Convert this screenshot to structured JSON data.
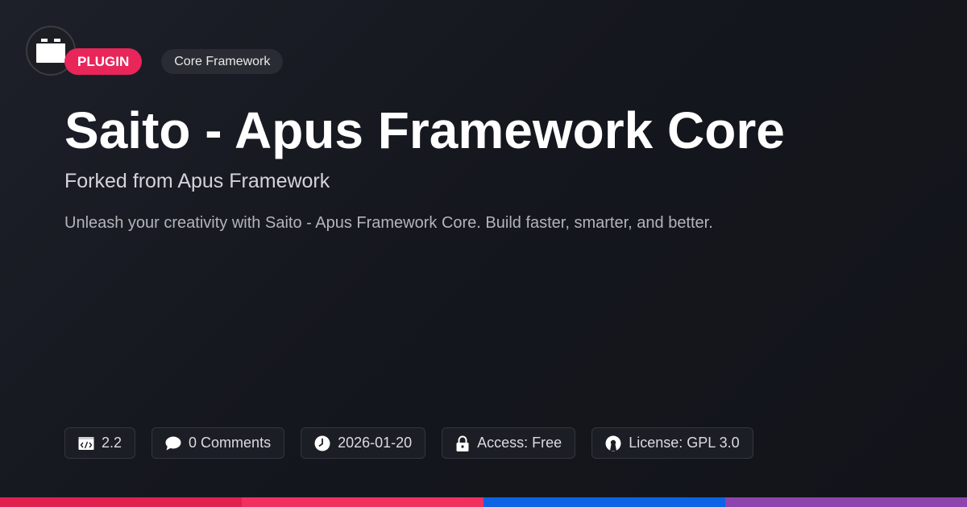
{
  "header": {
    "logo_icon": "plugin-block-icon",
    "type_badge": "PLUGIN",
    "category_badge": "Core Framework"
  },
  "main": {
    "title": "Saito - Apus Framework Core",
    "subtitle": "Forked from Apus Framework",
    "description": "Unleash your creativity with Saito - Apus Framework Core. Build faster, smarter, and better."
  },
  "meta": [
    {
      "icon": "code-window-icon",
      "text": "2.2"
    },
    {
      "icon": "comment-bubble-icon",
      "text": "0 Comments"
    },
    {
      "icon": "clock-icon",
      "text": "2026-01-20"
    },
    {
      "icon": "lock-icon",
      "text": "Access: Free"
    },
    {
      "icon": "open-source-icon",
      "text": "License: GPL 3.0"
    }
  ],
  "colors": {
    "accent": "#e8265a",
    "bar": [
      "#e0204f",
      "#f0305f",
      "#0c63e4",
      "#8e44ad"
    ]
  }
}
